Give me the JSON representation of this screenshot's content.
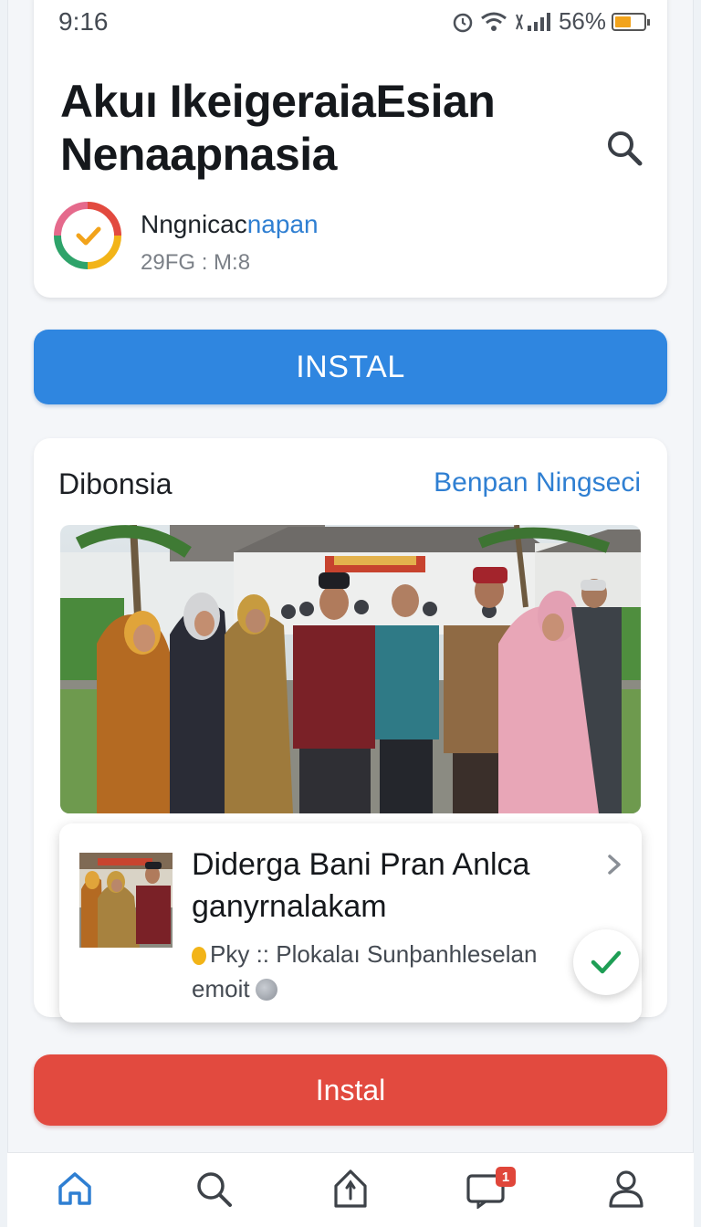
{
  "status_bar": {
    "time": "9:16",
    "battery_text": "56%",
    "battery_level": 0.56
  },
  "app": {
    "title": "Akuı IkeigeraiaEsian Nenaapnasia",
    "developer_dark": "Nngnicac",
    "developer_highlight": "napan",
    "meta": "29FG : M:8"
  },
  "primary_action": {
    "label": "INSTAL"
  },
  "section": {
    "title": "Dibonsia",
    "link": "Benpan Ningseci"
  },
  "feature_card": {
    "title": "Diderga Bani Pran Anlca ganyrnalakam",
    "subtitle": "Pky :: Plokalaı Sunþanhleselan emoit"
  },
  "secondary_action": {
    "label": "Instal"
  },
  "bottom_nav": {
    "items": [
      "home",
      "search",
      "updates",
      "notifications",
      "profile"
    ],
    "notification_count": "1"
  },
  "colors": {
    "blue": "#2f86e0",
    "red": "#e24a3f",
    "link": "#2f7fd2",
    "check": "#1e9e55"
  }
}
